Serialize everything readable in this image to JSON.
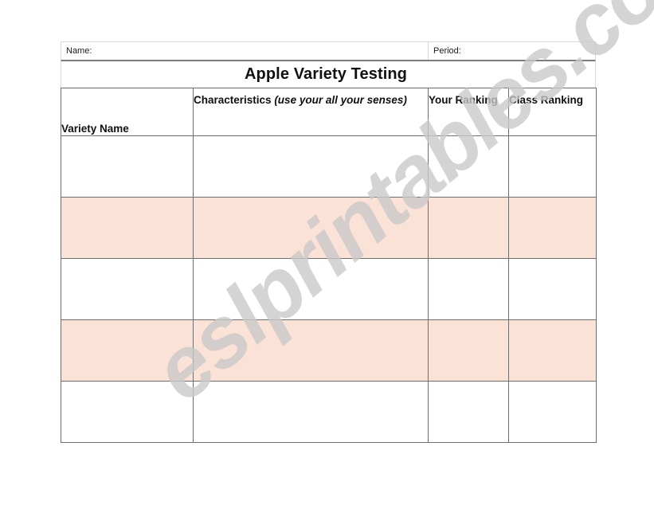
{
  "worksheet": {
    "id_fields": [
      {
        "label": "Name:",
        "value": ""
      },
      {
        "label": "Period:",
        "value": ""
      }
    ],
    "title": "Apple Variety Testing",
    "columns": [
      {
        "key": "variety",
        "label": "Variety Name",
        "emphasis": ""
      },
      {
        "key": "characteristics",
        "label": "Characteristics ",
        "emphasis": "(use your all your senses)"
      },
      {
        "key": "your_ranking",
        "label": "Your Ranking",
        "emphasis": ""
      },
      {
        "key": "class_ranking",
        "label": "Class Ranking",
        "emphasis": ""
      }
    ],
    "rows": [
      {
        "variety": "",
        "characteristics": "",
        "your_ranking": "",
        "class_ranking": "",
        "shaded": false
      },
      {
        "variety": "",
        "characteristics": "",
        "your_ranking": "",
        "class_ranking": "",
        "shaded": true
      },
      {
        "variety": "",
        "characteristics": "",
        "your_ranking": "",
        "class_ranking": "",
        "shaded": false
      },
      {
        "variety": "",
        "characteristics": "",
        "your_ranking": "",
        "class_ranking": "",
        "shaded": true
      },
      {
        "variety": "",
        "characteristics": "",
        "your_ranking": "",
        "class_ranking": "",
        "shaded": false
      }
    ],
    "colors": {
      "header_orange": "#f16522",
      "row_shade_pink": "#fbe2d6",
      "grid_line": "#6e6e6e",
      "id_grid_line": "#d9d9d9",
      "watermark_gray": "#c9c9c9"
    }
  },
  "watermark": {
    "text": "eslprintables.com"
  }
}
